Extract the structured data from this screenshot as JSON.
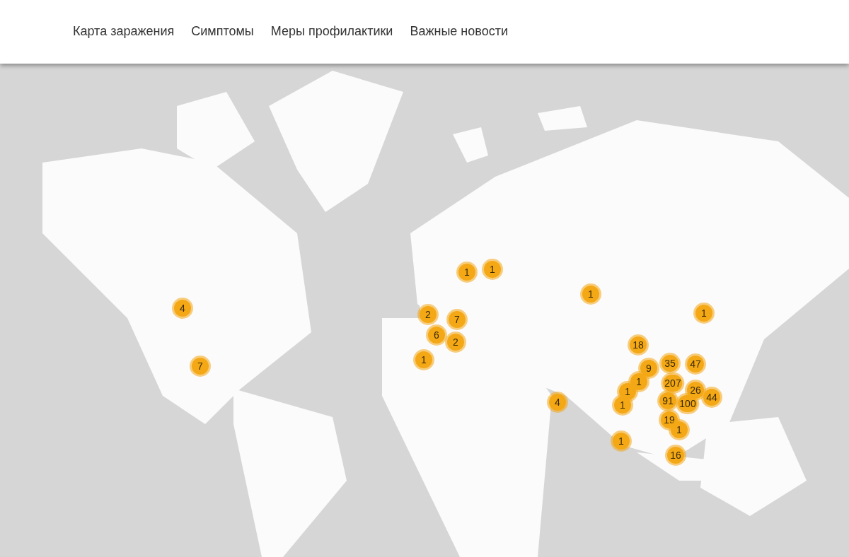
{
  "nav": [
    {
      "label": "Карта заражения"
    },
    {
      "label": "Симптомы"
    },
    {
      "label": "Меры профилактики"
    },
    {
      "label": "Важные новости"
    }
  ],
  "map": {
    "kind": "picture",
    "markers": [
      {
        "count": "4"
      },
      {
        "count": "7"
      },
      {
        "count": "1"
      },
      {
        "count": "1"
      },
      {
        "count": "2"
      },
      {
        "count": "7"
      },
      {
        "count": "6"
      },
      {
        "count": "2"
      },
      {
        "count": "1"
      },
      {
        "count": "1"
      },
      {
        "count": "1"
      },
      {
        "count": "18"
      },
      {
        "count": "35"
      },
      {
        "count": "47"
      },
      {
        "count": "9"
      },
      {
        "count": "207"
      },
      {
        "count": "1"
      },
      {
        "count": "1"
      },
      {
        "count": "26"
      },
      {
        "count": "1"
      },
      {
        "count": "91"
      },
      {
        "count": "100"
      },
      {
        "count": "44"
      },
      {
        "count": "19"
      },
      {
        "count": "1"
      },
      {
        "count": "4"
      },
      {
        "count": "1"
      },
      {
        "count": "16"
      }
    ]
  }
}
